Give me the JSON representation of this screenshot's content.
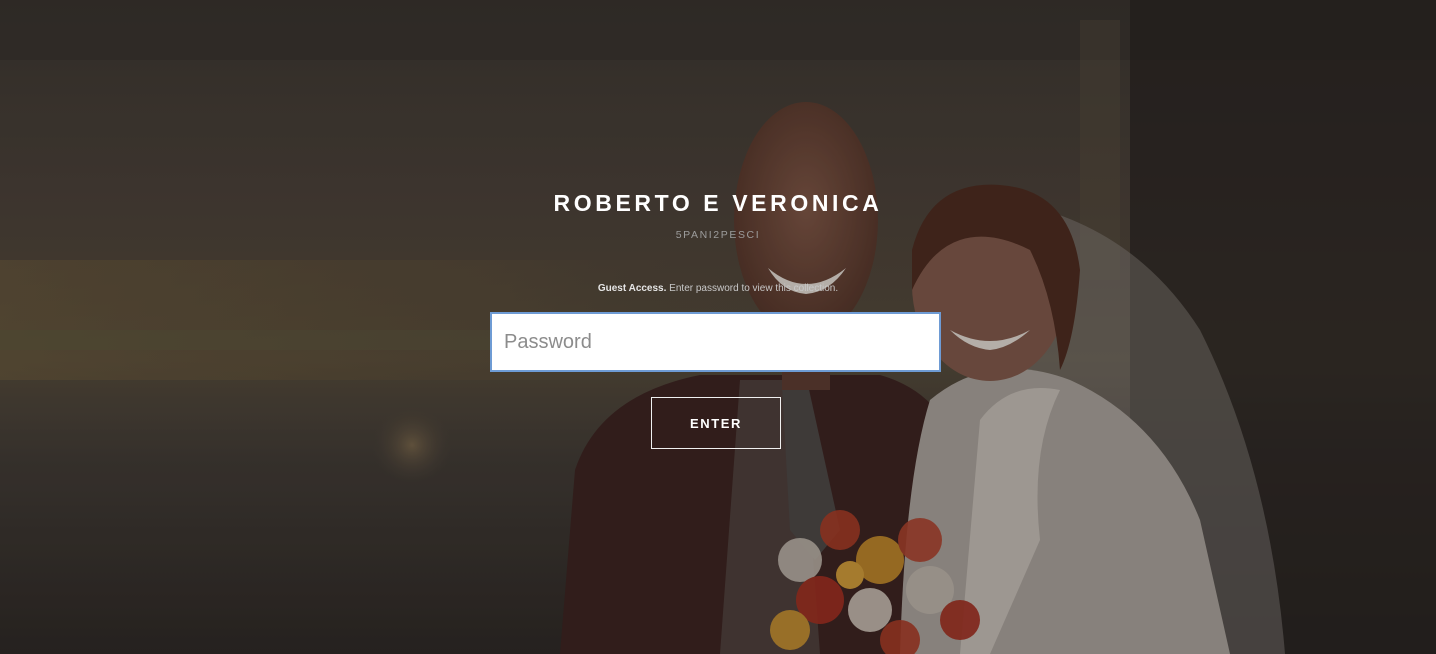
{
  "gallery": {
    "title": "ROBERTO E VERONICA",
    "studio": "5PANI2PESCI"
  },
  "access": {
    "label": "Guest Access.",
    "instruction": " Enter password to view this collection."
  },
  "password": {
    "placeholder": "Password",
    "value": ""
  },
  "enter_button": {
    "label": "ENTER"
  },
  "background": {
    "description_icon": "wedding-photo",
    "tint": "#2a2623"
  }
}
